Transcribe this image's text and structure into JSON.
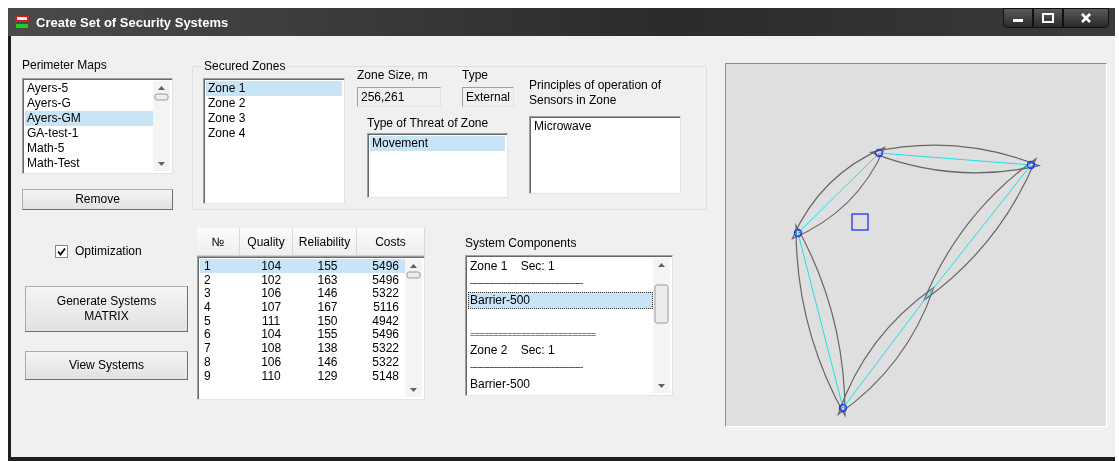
{
  "window": {
    "title": "Create Set of Security Systems"
  },
  "perimeter_maps": {
    "label": "Perimeter Maps",
    "items": [
      {
        "label": "Ayers-5",
        "selected": false
      },
      {
        "label": "Ayers-G",
        "selected": false
      },
      {
        "label": "Ayers-GM",
        "selected": true
      },
      {
        "label": "GA-test-1",
        "selected": false
      },
      {
        "label": "Math-5",
        "selected": false
      },
      {
        "label": "Math-Test",
        "selected": false
      }
    ]
  },
  "remove_button": "Remove",
  "secured_zones": {
    "label": "Secured Zones",
    "items": [
      {
        "label": "Zone 1",
        "selected": true
      },
      {
        "label": "Zone 2",
        "selected": false
      },
      {
        "label": "Zone 3",
        "selected": false
      },
      {
        "label": "Zone 4",
        "selected": false
      }
    ]
  },
  "zone_size": {
    "label": "Zone Size, m",
    "value": "256,261"
  },
  "zone_type": {
    "label": "Type",
    "value": "External"
  },
  "threat": {
    "label": "Type of Threat of Zone",
    "items": [
      {
        "label": "Movement",
        "selected": true
      }
    ]
  },
  "principles": {
    "label": "Principles of operation of Sensors in Zone",
    "items": [
      {
        "label": "Microwave",
        "selected": false
      }
    ]
  },
  "optimization": {
    "label": "Optimization",
    "checked": true
  },
  "buttons": [
    "Generate Systems MATRIX",
    "View Systems"
  ],
  "table": {
    "columns": [
      "№",
      "Quality",
      "Reliability",
      "Costs"
    ],
    "rows": [
      {
        "cells": [
          "1",
          "104",
          "155",
          "5496"
        ],
        "selected": true
      },
      {
        "cells": [
          "2",
          "102",
          "163",
          "5496"
        ],
        "selected": false
      },
      {
        "cells": [
          "3",
          "106",
          "146",
          "5322"
        ],
        "selected": false
      },
      {
        "cells": [
          "4",
          "107",
          "167",
          "5116"
        ],
        "selected": false
      },
      {
        "cells": [
          "5",
          "111",
          "150",
          "4942"
        ],
        "selected": false
      },
      {
        "cells": [
          "6",
          "104",
          "155",
          "5496"
        ],
        "selected": false
      },
      {
        "cells": [
          "7",
          "108",
          "138",
          "5322"
        ],
        "selected": false
      },
      {
        "cells": [
          "8",
          "106",
          "146",
          "5322"
        ],
        "selected": false
      },
      {
        "cells": [
          "9",
          "110",
          "129",
          "5148"
        ],
        "selected": false
      }
    ]
  },
  "system_components": {
    "label": "System Components",
    "lines": [
      {
        "kind": "text",
        "text": "Zone 1    Sec: 1",
        "selected": false
      },
      {
        "kind": "separator",
        "text": "-----------------------------------------------",
        "selected": false
      },
      {
        "kind": "text",
        "text": "Barrier-500",
        "selected": true
      },
      {
        "kind": "blank",
        "selected": false
      },
      {
        "kind": "separator",
        "text": "===========================",
        "selected": false
      },
      {
        "kind": "text",
        "text": "Zone 2    Sec: 1",
        "selected": false
      },
      {
        "kind": "separator",
        "text": "-----------------------------------------------",
        "selected": false
      },
      {
        "kind": "text",
        "text": "Barrier-500",
        "selected": false
      }
    ]
  }
}
